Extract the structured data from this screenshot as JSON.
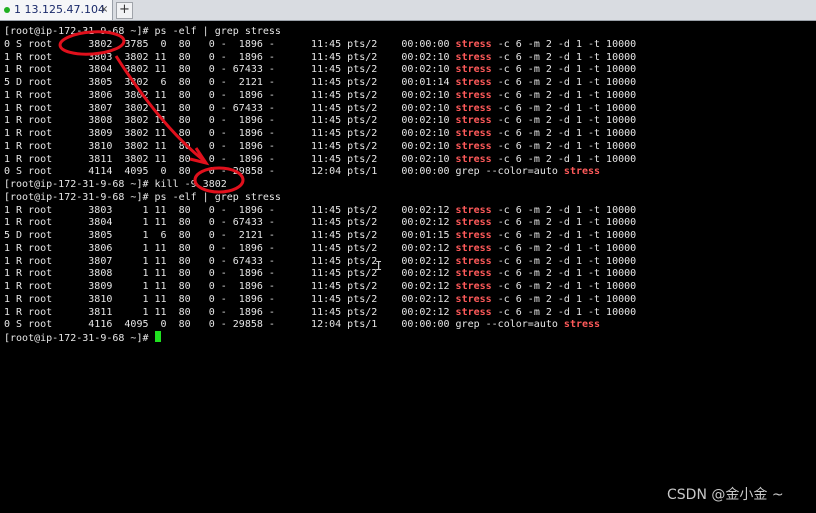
{
  "tab": {
    "label": "1 13.125.47.104",
    "close": "×",
    "add": "+"
  },
  "terminal": {
    "lines": [
      {
        "pre": "[root@ip-172-31-9-68 ~]# ps -elf | grep stress"
      },
      {
        "pre": "0 S root      3802  3785  0  80   0 -  1896 -      11:45 pts/2    00:00:00 ",
        "hl": "stress",
        "post": " -c 6 -m 2 -d 1 -t 10000"
      },
      {
        "pre": "1 R root      3803  3802 11  80   0 -  1896 -      11:45 pts/2    00:02:10 ",
        "hl": "stress",
        "post": " -c 6 -m 2 -d 1 -t 10000"
      },
      {
        "pre": "1 R root      3804  3802 11  80   0 - 67433 -      11:45 pts/2    00:02:10 ",
        "hl": "stress",
        "post": " -c 6 -m 2 -d 1 -t 10000"
      },
      {
        "pre": "5 D root      3805  3802  6  80   0 -  2121 -      11:45 pts/2    00:01:14 ",
        "hl": "stress",
        "post": " -c 6 -m 2 -d 1 -t 10000"
      },
      {
        "pre": "1 R root      3806  3802 11  80   0 -  1896 -      11:45 pts/2    00:02:10 ",
        "hl": "stress",
        "post": " -c 6 -m 2 -d 1 -t 10000"
      },
      {
        "pre": "1 R root      3807  3802 11  80   0 - 67433 -      11:45 pts/2    00:02:10 ",
        "hl": "stress",
        "post": " -c 6 -m 2 -d 1 -t 10000"
      },
      {
        "pre": "1 R root      3808  3802 11  80   0 -  1896 -      11:45 pts/2    00:02:10 ",
        "hl": "stress",
        "post": " -c 6 -m 2 -d 1 -t 10000"
      },
      {
        "pre": "1 R root      3809  3802 11  80   0 -  1896 -      11:45 pts/2    00:02:10 ",
        "hl": "stress",
        "post": " -c 6 -m 2 -d 1 -t 10000"
      },
      {
        "pre": "1 R root      3810  3802 11  80   0 -  1896 -      11:45 pts/2    00:02:10 ",
        "hl": "stress",
        "post": " -c 6 -m 2 -d 1 -t 10000"
      },
      {
        "pre": "1 R root      3811  3802 11  80   0 -  1896 -      11:45 pts/2    00:02:10 ",
        "hl": "stress",
        "post": " -c 6 -m 2 -d 1 -t 10000"
      },
      {
        "pre": "0 S root      4114  4095  0  80   0 - 29858 -      12:04 pts/1    00:00:00 grep --color=auto ",
        "hl": "stress",
        "post": ""
      },
      {
        "pre": "[root@ip-172-31-9-68 ~]# kill -9 3802"
      },
      {
        "pre": "[root@ip-172-31-9-68 ~]# ps -elf | grep stress"
      },
      {
        "pre": "1 R root      3803     1 11  80   0 -  1896 -      11:45 pts/2    00:02:12 ",
        "hl": "stress",
        "post": " -c 6 -m 2 -d 1 -t 10000"
      },
      {
        "pre": "1 R root      3804     1 11  80   0 - 67433 -      11:45 pts/2    00:02:12 ",
        "hl": "stress",
        "post": " -c 6 -m 2 -d 1 -t 10000"
      },
      {
        "pre": "5 D root      3805     1  6  80   0 -  2121 -      11:45 pts/2    00:01:15 ",
        "hl": "stress",
        "post": " -c 6 -m 2 -d 1 -t 10000"
      },
      {
        "pre": "1 R root      3806     1 11  80   0 -  1896 -      11:45 pts/2    00:02:12 ",
        "hl": "stress",
        "post": " -c 6 -m 2 -d 1 -t 10000"
      },
      {
        "pre": "1 R root      3807     1 11  80   0 - 67433 -      11:45 pts/2    00:02:12 ",
        "hl": "stress",
        "post": " -c 6 -m 2 -d 1 -t 10000"
      },
      {
        "pre": "1 R root      3808     1 11  80   0 -  1896 -      11:45 pts/2    00:02:12 ",
        "hl": "stress",
        "post": " -c 6 -m 2 -d 1 -t 10000"
      },
      {
        "pre": "1 R root      3809     1 11  80   0 -  1896 -      11:45 pts/2    00:02:12 ",
        "hl": "stress",
        "post": " -c 6 -m 2 -d 1 -t 10000"
      },
      {
        "pre": "1 R root      3810     1 11  80   0 -  1896 -      11:45 pts/2    00:02:12 ",
        "hl": "stress",
        "post": " -c 6 -m 2 -d 1 -t 10000"
      },
      {
        "pre": "1 R root      3811     1 11  80   0 -  1896 -      11:45 pts/2    00:02:12 ",
        "hl": "stress",
        "post": " -c 6 -m 2 -d 1 -t 10000"
      },
      {
        "pre": "0 S root      4116  4095  0  80   0 - 29858 -      12:04 pts/1    00:00:00 grep --color=auto ",
        "hl": "stress",
        "post": ""
      },
      {
        "pre": "[root@ip-172-31-9-68 ~]# ",
        "cursor": true
      }
    ]
  },
  "watermark": "CSDN @金小金 ~",
  "colors": {
    "highlight": "#ff5a5a",
    "annotation": "#e0101c",
    "cursor": "#20e020",
    "tab_dot": "#20b020"
  }
}
